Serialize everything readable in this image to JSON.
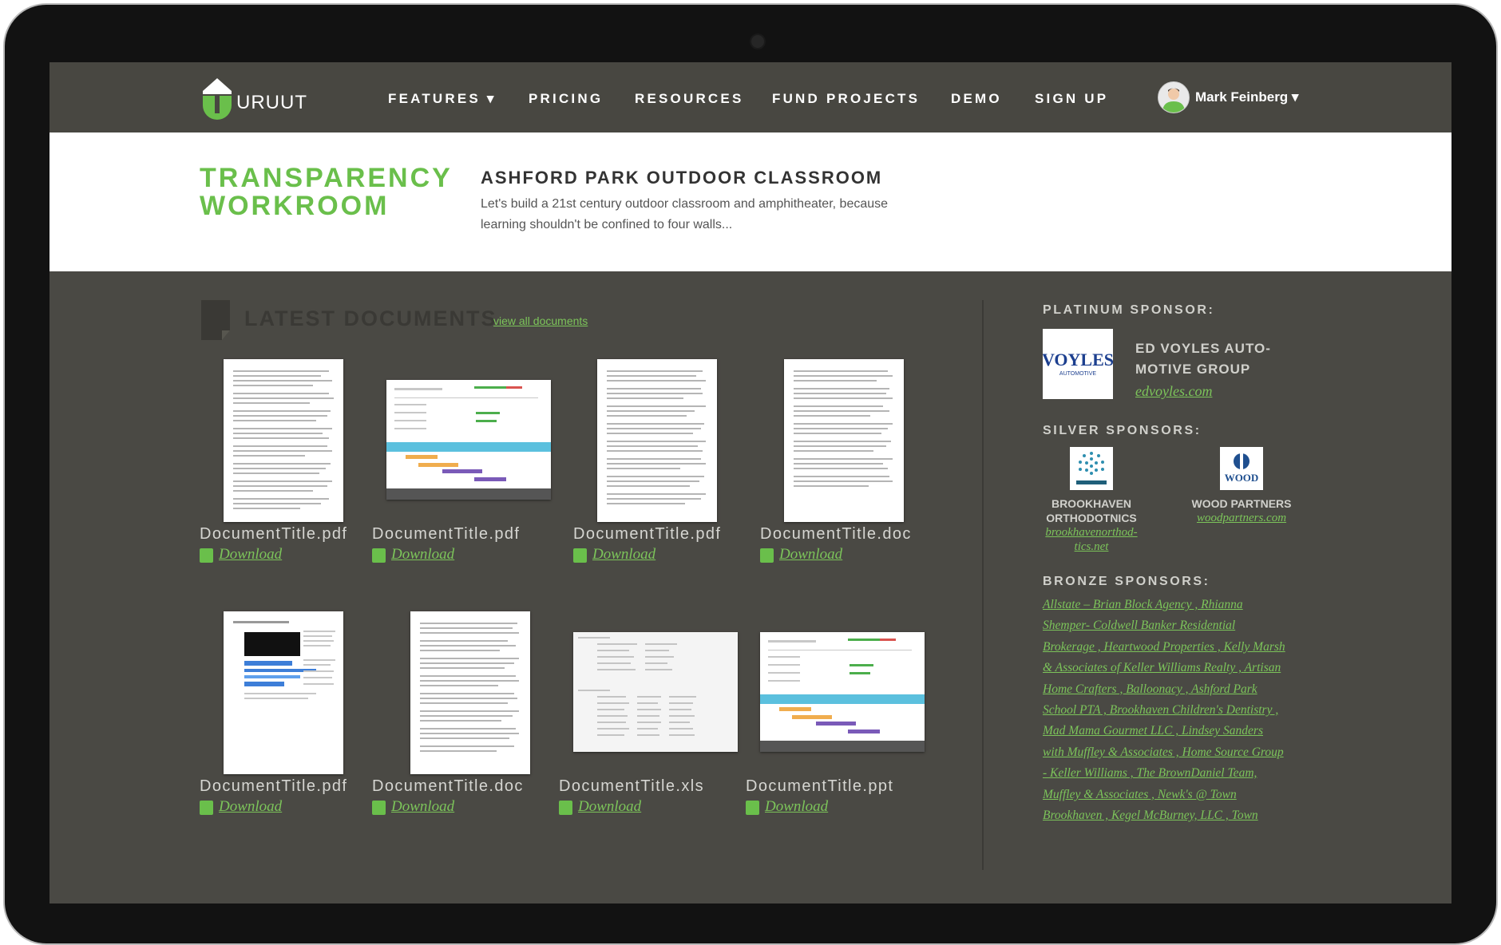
{
  "nav": {
    "logo_text": "URUUT",
    "items": [
      "FEATURES ▾",
      "PRICING",
      "RESOURCES",
      "FUND PROJECTS",
      "DEMO",
      "SIGN UP"
    ],
    "user_name": "Mark Feinberg ▾"
  },
  "header": {
    "title_line1": "TRANSPARENCY",
    "title_line2": "WORKROOM",
    "project_title": "ASHFORD PARK OUTDOOR CLASSROOM",
    "project_description": "Let's build a 21st century outdoor classroom and amphitheater, because learning shouldn't be confined to four walls..."
  },
  "documents": {
    "heading": "LATEST DOCUMENTS",
    "view_all": "view all documents",
    "download_label": "Download",
    "items": [
      {
        "name": "DocumentTitle.pdf",
        "kind": "pdf"
      },
      {
        "name": "DocumentTitle.pdf",
        "kind": "pdf"
      },
      {
        "name": "DocumentTitle.pdf",
        "kind": "pdf"
      },
      {
        "name": "DocumentTitle.doc",
        "kind": "doc"
      },
      {
        "name": "DocumentTitle.pdf",
        "kind": "pdf"
      },
      {
        "name": "DocumentTitle.doc",
        "kind": "doc"
      },
      {
        "name": "DocumentTitle.xls",
        "kind": "xls"
      },
      {
        "name": "DocumentTitle.ppt",
        "kind": "ppt"
      }
    ]
  },
  "sponsors": {
    "platinum_label": "PLATINUM SPONSOR:",
    "platinum": {
      "logo_text": "VOYLES",
      "logo_sub": "AUTOMOTIVE",
      "name_line1": "ED VOYLES AUTO-",
      "name_line2": "MOTIVE GROUP",
      "link": "edvoyles.com"
    },
    "silver_label": "SILVER SPONSORS:",
    "silver": [
      {
        "name_line1": "BROOKHAVEN",
        "name_line2": "ORTHODOTNICS",
        "link_line1": "brookhavenorthod-",
        "link_line2": "tics.net"
      },
      {
        "name_line1": "WOOD PARTNERS",
        "name_line2": "",
        "link_line1": "woodpartners.com",
        "link_line2": ""
      }
    ],
    "bronze_label": "BRONZE SPONSORS:",
    "bronze_lines": [
      "Allstate – Brian Block Agency , Rhianna",
      "Shemper- Coldwell Banker Residential",
      "Brokerage , Heartwood Properties , Kelly Marsh",
      "& Associates of Keller Williams Realty , Artisan",
      "Home Crafters , Balloonacy , Ashford Park",
      "School PTA , Brookhaven Children's Dentistry ,",
      "Mad Mama Gourmet LLC , Lindsey Sanders",
      "with Muffley & Associates , Home Source Group",
      "- Keller Williams , The BrownDaniel Team,",
      "Muffley & Associates , Newk's @ Town",
      "Brookhaven , Kegel McBurney, LLC , Town"
    ]
  }
}
